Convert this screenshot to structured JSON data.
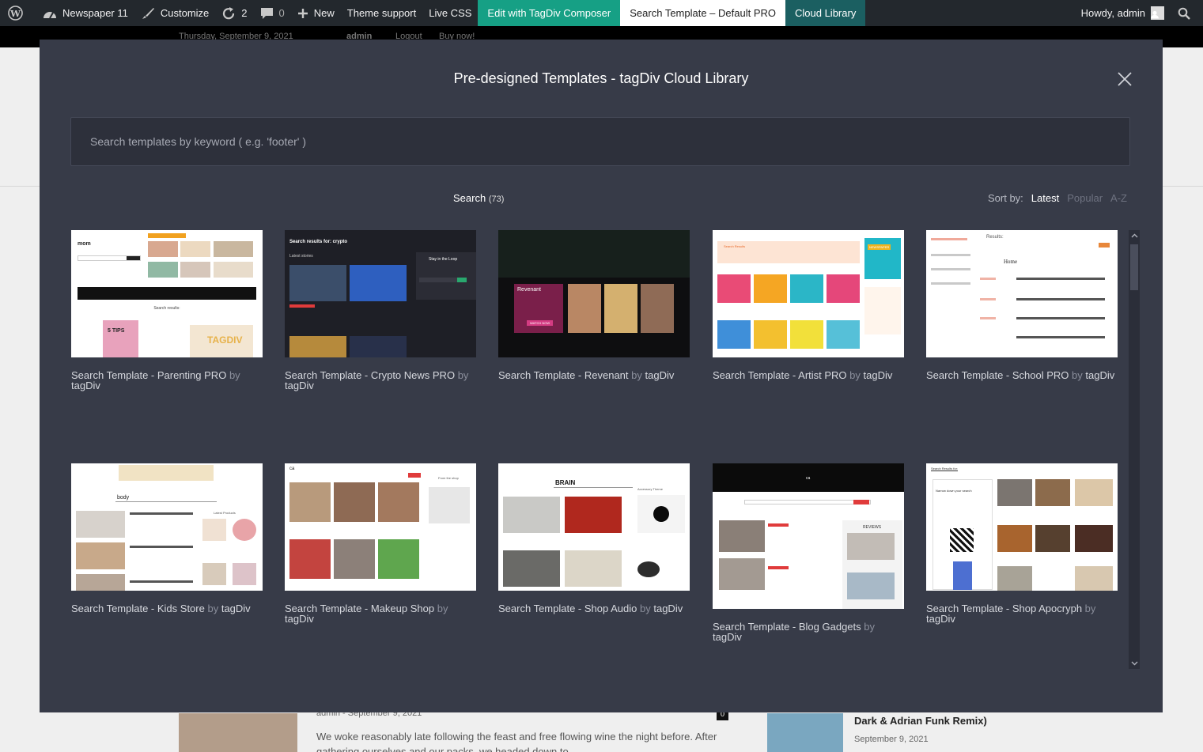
{
  "adminbar": {
    "site_name": "Newspaper 11",
    "customize": "Customize",
    "updates_count": "2",
    "comments_count": "0",
    "new_label": "New",
    "theme_support": "Theme support",
    "live_css": "Live CSS",
    "edit_composer": "Edit with TagDiv Composer",
    "current_template": "Search Template – Default PRO",
    "cloud_library": "Cloud Library",
    "howdy": "Howdy, admin"
  },
  "background_page": {
    "date": "Thursday, September 9, 2021",
    "user": "admin",
    "logout": "Logout",
    "buy_now": "Buy now!",
    "post_meta": "admin - September 9, 2021",
    "post_excerpt": "We woke reasonably late following the feast and free flowing wine the night before. After gathering ourselves and our packs, we headed down to",
    "comment_badge": "0",
    "right_title": "Dark & Adrian Funk Remix)",
    "right_date": "September 9, 2021"
  },
  "modal": {
    "title": "Pre-designed Templates - tagDiv Cloud Library",
    "search_placeholder": "Search templates by keyword ( e.g. 'footer' )",
    "search_value": "",
    "result_label": "Search",
    "result_count": "(73)",
    "sort_label": "Sort by:",
    "sort_options": [
      "Latest",
      "Popular",
      "A-Z"
    ],
    "sort_active": "Latest"
  },
  "templates": [
    {
      "name": "Search Template - Parenting PRO",
      "by": "by",
      "author": "tagDiv",
      "thumb_text": "mom",
      "thumb_sub": "Search results:"
    },
    {
      "name": "Search Template - Crypto News PRO",
      "by": "by",
      "author": "tagDiv",
      "thumb_text": "Search results for: crypto",
      "thumb_sub": "Latest stories"
    },
    {
      "name": "Search Template - Revenant",
      "by": "by",
      "author": "tagDiv",
      "thumb_text": "Revenant",
      "thumb_sub": "WATCH NOW"
    },
    {
      "name": "Search Template - Artist PRO",
      "by": "by",
      "author": "tagDiv",
      "thumb_text": "Search Results",
      "thumb_sub": "NEWSPAPER"
    },
    {
      "name": "Search Template - School PRO",
      "by": "by",
      "author": "tagDiv",
      "thumb_text": "Results:",
      "thumb_sub": "Home"
    },
    {
      "name": "Search Template - Kids Store",
      "by": "by",
      "author": "tagDiv",
      "thumb_text": "body",
      "thumb_sub": "Latest Products"
    },
    {
      "name": "Search Template - Makeup Shop",
      "by": "by",
      "author": "tagDiv",
      "thumb_text": "ca",
      "thumb_sub": "From the shop"
    },
    {
      "name": "Search Template - Shop Audio",
      "by": "by",
      "author": "tagDiv",
      "thumb_text": "BRAIN",
      "thumb_sub": "Accessory Theme"
    },
    {
      "name": "Search Template - Blog Gadgets",
      "by": "by",
      "author": "tagDiv",
      "thumb_text": "ca",
      "thumb_sub": "REVIEWS"
    },
    {
      "name": "Search Template - Shop Apocryph",
      "by": "by",
      "author": "tagDiv",
      "thumb_text": "Search Results for:",
      "thumb_sub": "Narrow down your search"
    }
  ],
  "colors": {
    "adminbar": "#23282d",
    "modal_bg": "#373b48",
    "composer_green": "#16a085",
    "cloud_teal": "#1b5f61",
    "accent_red": "#e03b3b",
    "accent_orange": "#f08a24"
  }
}
